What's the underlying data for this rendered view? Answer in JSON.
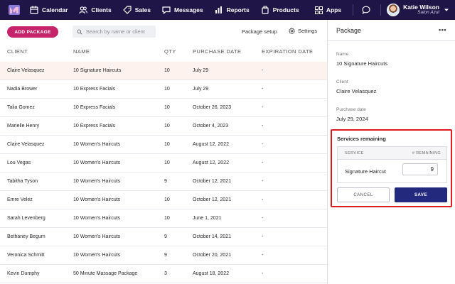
{
  "nav": {
    "items": [
      {
        "label": "Calendar",
        "icon": "calendar-icon"
      },
      {
        "label": "Clients",
        "icon": "clients-icon"
      },
      {
        "label": "Sales",
        "icon": "sales-tag-icon"
      },
      {
        "label": "Messages",
        "icon": "messages-icon"
      },
      {
        "label": "Reports",
        "icon": "reports-icon"
      },
      {
        "label": "Products",
        "icon": "products-icon"
      }
    ],
    "apps_label": "Apps",
    "user_name": "Katie Wilson",
    "user_business": "Salon Azul",
    "bg_color": "#1f1547"
  },
  "toolbar": {
    "add_label": "ADD PACKAGE",
    "add_color": "#c5246a",
    "search_placeholder": "Search by name or client",
    "package_setup_label": "Package setup",
    "settings_label": "Settings"
  },
  "table": {
    "headers": [
      "CLIENT",
      "NAME",
      "QTY",
      "PURCHASE DATE",
      "EXPIRATION DATE"
    ],
    "rows": [
      {
        "client": "Claire Velasquez",
        "name": "10 Signature Haircuts",
        "qty": "10",
        "purchase": "July 29",
        "expiration": "-"
      },
      {
        "client": "Nadia Brower",
        "name": "10 Express Facials",
        "qty": "10",
        "purchase": "July 29",
        "expiration": "-"
      },
      {
        "client": "Talia Gomez",
        "name": "10 Express Facials",
        "qty": "10",
        "purchase": "October 26, 2023",
        "expiration": "-"
      },
      {
        "client": "Marielle Henry",
        "name": "10 Express Facials",
        "qty": "10",
        "purchase": "October 4, 2023",
        "expiration": "-"
      },
      {
        "client": "Claire Velasquez",
        "name": "10 Women's Haircuts",
        "qty": "10",
        "purchase": "August 12, 2022",
        "expiration": "-"
      },
      {
        "client": "Lou Vegas",
        "name": "10 Women's Haircuts",
        "qty": "10",
        "purchase": "August 12, 2022",
        "expiration": "-"
      },
      {
        "client": "Tabitha Tyson",
        "name": "10 Women's Haircuts",
        "qty": "9",
        "purchase": "October 12, 2021",
        "expiration": "-"
      },
      {
        "client": "Emre Velez",
        "name": "10 Women's Haircuts",
        "qty": "10",
        "purchase": "October 12, 2021",
        "expiration": "-"
      },
      {
        "client": "Sarah Levenberg",
        "name": "10 Women's Haircuts",
        "qty": "10",
        "purchase": "June 1, 2021",
        "expiration": "-"
      },
      {
        "client": "Bethaney Begum",
        "name": "10 Women's Haircuts",
        "qty": "9",
        "purchase": "October 14, 2021",
        "expiration": "-"
      },
      {
        "client": "Veronica Schmitt",
        "name": "10 Women's Haircuts",
        "qty": "9",
        "purchase": "October 20, 2021",
        "expiration": "-"
      },
      {
        "client": "Kevin Dumphy",
        "name": "50 Minute Massage Package",
        "qty": "3",
        "purchase": "August 18, 2022",
        "expiration": "-"
      }
    ],
    "selected_row_color": "#fdf2ee"
  },
  "panel": {
    "title": "Package",
    "more_label": "•••",
    "name_label": "Name",
    "name_value": "10 Signature Haircuts",
    "client_label": "Client",
    "client_value": "Claire Velasquez",
    "purchase_label": "Purchase date",
    "purchase_value": "July 29, 2024",
    "services": {
      "title": "Services remaining",
      "col_service": "SERVICE",
      "col_remaining": "# REMAINING",
      "service_name": "Signature Haircut",
      "remaining_value": "9",
      "cancel_label": "CANCEL",
      "save_label": "SAVE",
      "highlight_color": "#e01b1b",
      "save_color": "#232a7e"
    }
  }
}
